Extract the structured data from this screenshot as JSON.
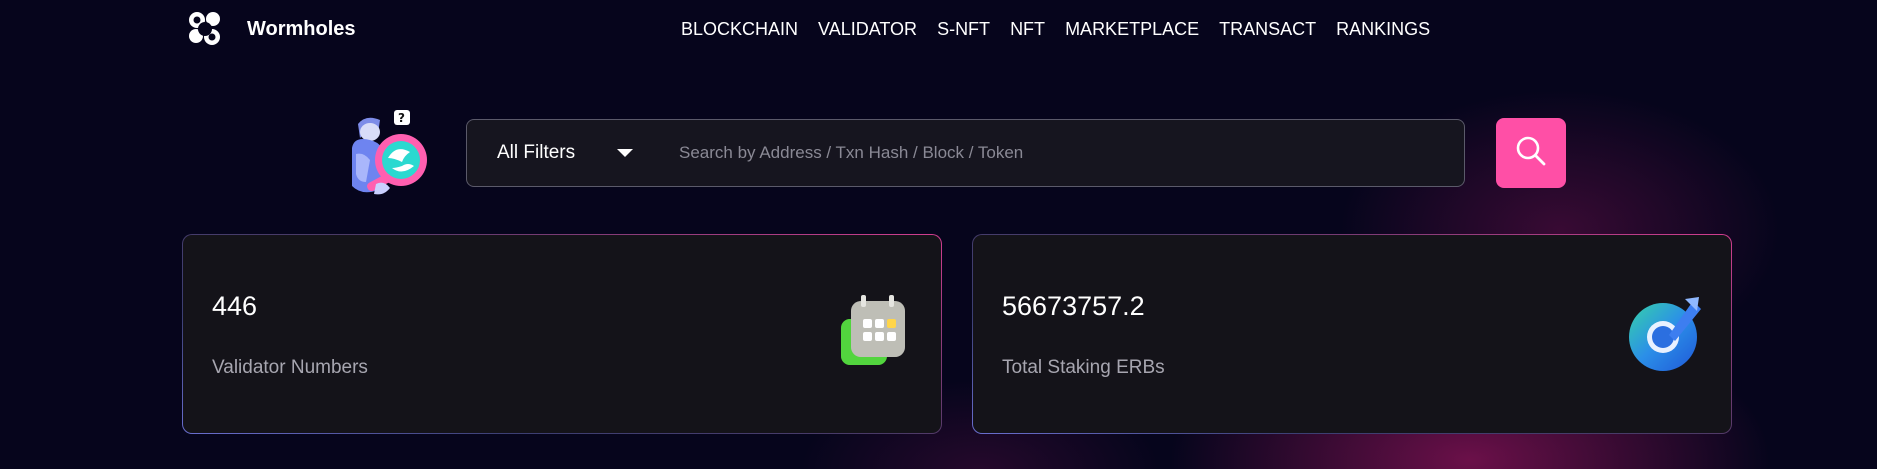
{
  "header": {
    "brand": "Wormholes",
    "nav": [
      "BLOCKCHAIN",
      "VALIDATOR",
      "S-NFT",
      "NFT",
      "MARKETPLACE",
      "TRANSACT",
      "RANKINGS"
    ]
  },
  "search": {
    "filter_label": "All Filters",
    "placeholder": "Search by Address / Txn Hash / Block / Token",
    "value": ""
  },
  "stats": [
    {
      "value": "446",
      "label": "Validator Numbers",
      "icon": "calendar-icon"
    },
    {
      "value": "56673757.2",
      "label": "Total Staking ERBs",
      "icon": "staking-icon"
    }
  ],
  "colors": {
    "background": "#06051c",
    "accent": "#ff4fa6",
    "card": "#141319"
  }
}
